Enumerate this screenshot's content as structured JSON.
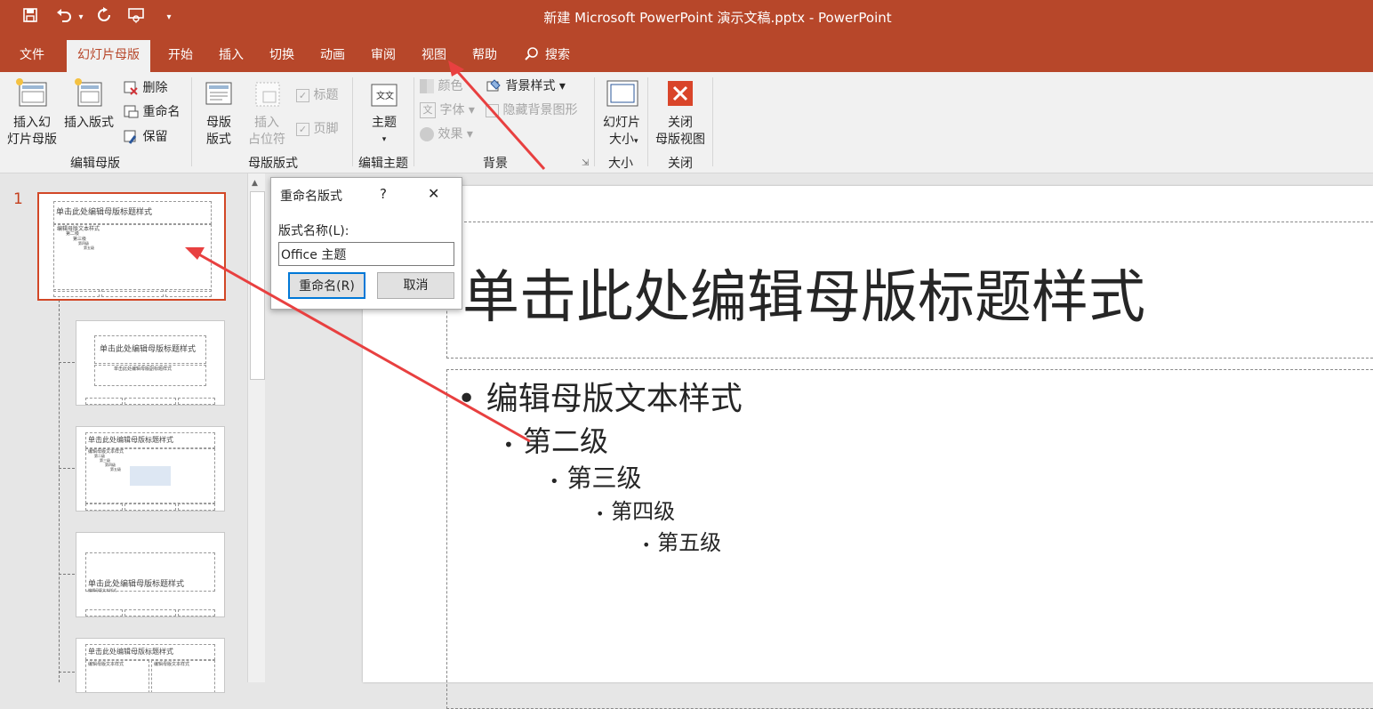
{
  "window": {
    "title": "新建 Microsoft PowerPoint 演示文稿.pptx  -  PowerPoint"
  },
  "qat": {
    "save_icon": "save-icon",
    "undo_icon": "undo-icon",
    "redo_icon": "redo-icon",
    "present_icon": "present-icon",
    "more": "▾"
  },
  "tabs": [
    "文件",
    "幻灯片母版",
    "开始",
    "插入",
    "切换",
    "动画",
    "审阅",
    "视图",
    "帮助",
    "搜索"
  ],
  "ribbon": {
    "edit_master": {
      "insert_master": "插入幻\n灯片母版",
      "insert_layout": "插入版式",
      "delete": "删除",
      "rename": "重命名",
      "preserve": "保留",
      "group": "编辑母版"
    },
    "master_layout": {
      "master_layout": "母版\n版式",
      "insert_placeholder": "插入\n占位符",
      "title": "标题",
      "footer": "页脚",
      "group": "母版版式"
    },
    "edit_theme": {
      "theme": "主题",
      "group": "编辑主题"
    },
    "background": {
      "colors": "颜色",
      "fonts": "字体",
      "effects": "效果",
      "bg_styles": "背景样式",
      "hide_bg": "隐藏背景图形",
      "group": "背景"
    },
    "size": {
      "slide_size": "幻灯片\n大小",
      "group": "大小"
    },
    "close": {
      "close_master": "关闭\n母版视图",
      "group": "关闭"
    }
  },
  "thumbnails": {
    "slide_number": "1",
    "master_title": "单击此处编辑母版标题样式",
    "master_text": [
      "编辑母版文本样式",
      "第二级",
      "第三级",
      "第四级",
      "第五级"
    ],
    "subtitle": "单击此处编辑母版副标题样式"
  },
  "dialog": {
    "title": "重命名版式",
    "help": "?",
    "close": "✕",
    "label": "版式名称(L):",
    "value": "Office 主题",
    "rename_button": "重命名(R)",
    "cancel_button": "取消"
  },
  "slide": {
    "title": "单击此处编辑母版标题样式",
    "levels": [
      "编辑母版文本样式",
      "第二级",
      "第三级",
      "第四级",
      "第五级"
    ]
  },
  "colors": {
    "accent": "#b7472a",
    "annotation_arrow": "#e84040"
  }
}
